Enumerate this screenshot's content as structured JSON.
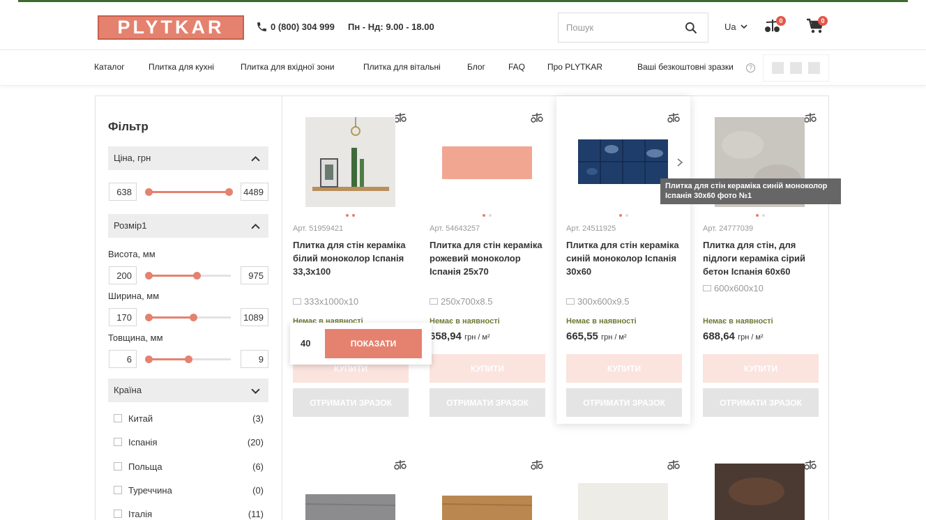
{
  "brand": {
    "logo_text": "PLYTKAR",
    "accent": "#e4826f"
  },
  "header": {
    "phone": "0 (800) 304 999",
    "hours": "Пн - Нд: 9.00 - 18.00",
    "search_placeholder": "Пошук",
    "lang": "Ua",
    "compare_count": "0",
    "cart_count": "0"
  },
  "nav": {
    "items": [
      "Каталог",
      "Плитка для кухні",
      "Плитка для вхідної зони",
      "Плитка для вітальні",
      "Блог",
      "FAQ",
      "Про PLYTKAR"
    ],
    "samples_label": "Ваші безкоштовні зразки"
  },
  "filter": {
    "title": "Фільтр",
    "price": {
      "label": "Ціна, грн",
      "min": "638",
      "max": "4489"
    },
    "size": {
      "label": "Розмір1",
      "height": {
        "label": "Висота, мм",
        "min": "200",
        "max": "975"
      },
      "width": {
        "label": "Ширина, мм",
        "min": "170",
        "max": "1089"
      },
      "thickness": {
        "label": "Товщина, мм",
        "min": "6",
        "max": "9"
      }
    },
    "country": {
      "label": "Країна",
      "items": [
        {
          "name": "Китай",
          "count": "(3)"
        },
        {
          "name": "Іспанія",
          "count": "(20)"
        },
        {
          "name": "Польща",
          "count": "(6)"
        },
        {
          "name": "Туреччина",
          "count": "(0)"
        },
        {
          "name": "Італія",
          "count": "(11)"
        }
      ]
    },
    "popup": {
      "count": "40",
      "button": "ПОКАЗАТИ"
    }
  },
  "products": [
    {
      "art": "Арт. 51959421",
      "name": "Плитка для стін кераміка білий моноколор Іспанія 33,3х100",
      "size": "333x1000x10",
      "stock": "Немає в наявності",
      "price": "",
      "unit": "",
      "buy": "КУПИТИ",
      "sample": "ОТРИМАТИ ЗРАЗОК"
    },
    {
      "art": "Арт. 54643257",
      "name": "Плитка для стін кераміка рожевий моноколор Іспанія 25х70",
      "size": "250x700x8.5",
      "stock": "Немає в наявності",
      "price": "658,94",
      "unit": "грн / м²",
      "buy": "КУПИТИ",
      "sample": "ОТРИМАТИ ЗРАЗОК"
    },
    {
      "art": "Арт. 24511925",
      "name": "Плитка для стін кераміка синій моноколор Іспанія 30х60",
      "size": "300x600x9.5",
      "stock": "Немає в наявності",
      "price": "665,55",
      "unit": "грн / м²",
      "buy": "КУПИТИ",
      "sample": "ОТРИМАТИ ЗРАЗОК"
    },
    {
      "art": "Арт. 24777039",
      "name": "Плитка для стін, для підлоги кераміка сірий бетон Іспанія 60х60",
      "size": "600x600x10",
      "stock": "Немає в наявності",
      "price": "688,64",
      "unit": "грн / м²",
      "buy": "КУПИТИ",
      "sample": "ОТРИМАТИ ЗРАЗОК"
    }
  ],
  "tooltip": "Плитка для стін кераміка синій моноколор Іспанія 30х60 фото №1"
}
